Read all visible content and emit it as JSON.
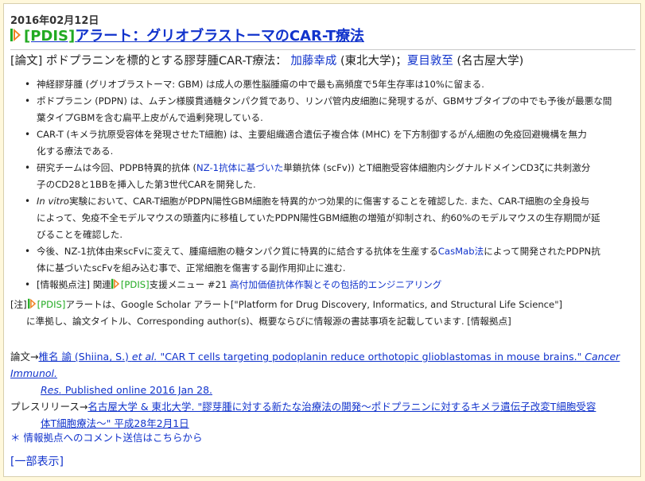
{
  "date": "2016年02月12日",
  "title": {
    "pdis": "[PDIS]",
    "text": "アラート：グリオブラストーマのCAR-T療法"
  },
  "paper_head": {
    "tag": "[論文] ポドプラニンを標的とする膠芽腫CAR-T療法：",
    "author1": "加藤幸成",
    "affil1": " (東北大学)；",
    "author2": "夏目敦至",
    "affil2": " (名古屋大学)"
  },
  "bullets": [
    {
      "lines": [
        "神経膠芽腫 (グリオブラストーマ: GBM) は成人の悪性脳腫瘍の中で最も高頻度で5年生存率は10%に留まる."
      ]
    },
    {
      "lines": [
        "ポドプラニン (PDPN) は、ムチン様膜貫通糖タンパク質であり、リンパ管内皮細胞に発現するが、GBMサブタイプの中でも予後が最悪な間",
        "葉タイプGBMを含む扁平上皮がんで過剰発現している."
      ]
    },
    {
      "lines": [
        "CAR-T (キメラ抗原受容体を発現させたT細胞) は、主要組織適合遺伝子複合体 (MHC) を下方制御するがん細胞の免疫回避機構を無力",
        "化する療法である."
      ]
    },
    {
      "pre": "研究チームは今回、PDPB特異的抗体 (",
      "link": "NZ-1抗体に基づいた",
      "post": "単鎖抗体 (scFv)) とT細胞受容体細胞内シグナルドメインCD3ζに共刺激分",
      "line2": "子のCD28と1BBを挿入した第3世代CARを開発した."
    },
    {
      "italic": "In vitro",
      "lines": [
        "実験において、CAR-T細胞がPDPN陽性GBM細胞を特異的かつ効果的に傷害することを確認した. また、CAR-T細胞の全身投与",
        "によって、免疫不全モデルマウスの頭蓋内に移植していたPDPN陽性GBM細胞の増殖が抑制され、約60%のモデルマウスの生存期間が延",
        "びることを確認した."
      ]
    },
    {
      "pre": "今後、NZ-1抗体由来scFvに変えて、腫瘍細胞の糖タンパク質に特異的に結合する抗体を生産する",
      "link": "CasMab法",
      "post": "によって開発されたPDPN抗",
      "line2": "体に基づいたscFvを組み込む事で、正常細胞を傷害する副作用抑止に進む."
    },
    {
      "pre": "[情報拠点注] 関連",
      "pdis": "[PDIS]",
      "mid": "支援メニュー #21 ",
      "link": "高付加価値抗体作製とその包括的エンジニアリング"
    }
  ],
  "note": {
    "prefix": "[注]",
    "pdis": "[PDIS]",
    "line1": "アラートは、Google Scholar アラート[\"Platform for Drug Discovery, Informatics, and Structural Life Science\"]",
    "line2": "に準拠し、論文タイトル、Corresponding author(s)、概要ならびに情報源の書誌事項を記載しています. [情報拠点]"
  },
  "references": {
    "paper_label": "論文→",
    "paper_author": "椎名 諭 (Shiina, S.) ",
    "paper_etal": "et al.",
    "paper_title": " \"CAR T cells targeting podoplanin reduce orthotopic glioblastomas in mouse brains.\" ",
    "paper_journal1": "Cancer Immunol.",
    "paper_journal2": "Res.",
    "paper_pub": " Published online 2016 Jan 28.",
    "press_label": "プレスリリース→",
    "press_line1": "名古屋大学 & 東北大学. \"膠芽腫に対する新たな治療法の開発～ポドプラニンに対するキメラ遺伝子改変T細胞受容",
    "press_line2": "体T細胞療法～\" 平成28年2月1日"
  },
  "comment_link": "＊ 情報拠点へのコメント送信はこちらから",
  "partial_link": "[一部表示]",
  "colors": {
    "link": "#1133cc",
    "pdis_green": "#22aa22",
    "logo_orange": "#f08020",
    "background": "#fff8dc"
  },
  "icons": {
    "logo": "pdis-logo-icon"
  }
}
